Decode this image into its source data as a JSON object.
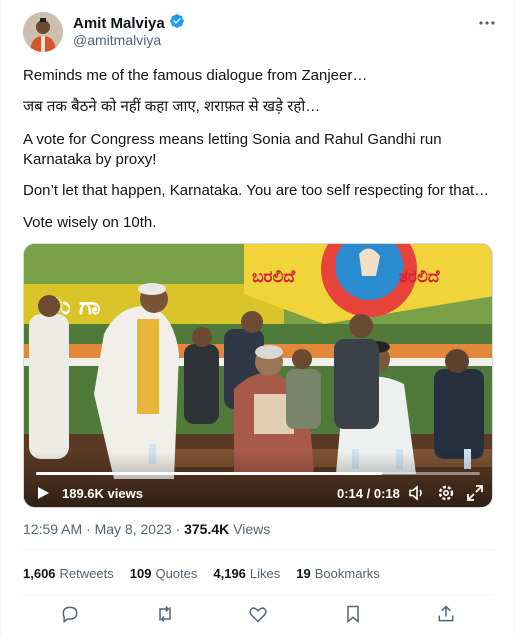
{
  "author": {
    "name": "Amit Malviya",
    "handle": "@amitmalviya"
  },
  "tweet": {
    "lines": [
      "Reminds me of the famous dialogue from Zanjeer…",
      "जब तक बैठने को नहीं कहा जाए, शराफ़त से खड़े रहो…",
      "A vote for Congress means letting Sonia and Rahul Gandhi run Karnataka by proxy!",
      "Don’t let that happen, Karnataka. You are too self respecting for that…",
      "Vote wisely on 10th."
    ]
  },
  "video": {
    "views": "189.6K views",
    "time": "0:14 / 0:18",
    "progress": 0.78,
    "banner_left": "ು ಗಾ",
    "banner_right_1": "ಬರಲಿದೆ",
    "banner_right_2": "ತರಲಿದೆ"
  },
  "meta": {
    "time": "12:59 AM · May 8, 2023 · ",
    "views_count": "375.4K",
    "views_label": " Views"
  },
  "stats": {
    "retweets_count": "1,606",
    "retweets_label": "Retweets",
    "quotes_count": "109",
    "quotes_label": "Quotes",
    "likes_count": "4,196",
    "likes_label": "Likes",
    "bookmarks_count": "19",
    "bookmarks_label": "Bookmarks"
  },
  "colors": {
    "verified": "#1d9bf0",
    "secondary_text": "#536471",
    "divider": "#eff3f4"
  },
  "icons": [
    "verified-badge-icon",
    "more-icon",
    "play-icon",
    "volume-icon",
    "settings-icon",
    "fullscreen-icon",
    "reply-icon",
    "retweet-icon",
    "like-icon",
    "bookmark-icon",
    "share-icon"
  ]
}
